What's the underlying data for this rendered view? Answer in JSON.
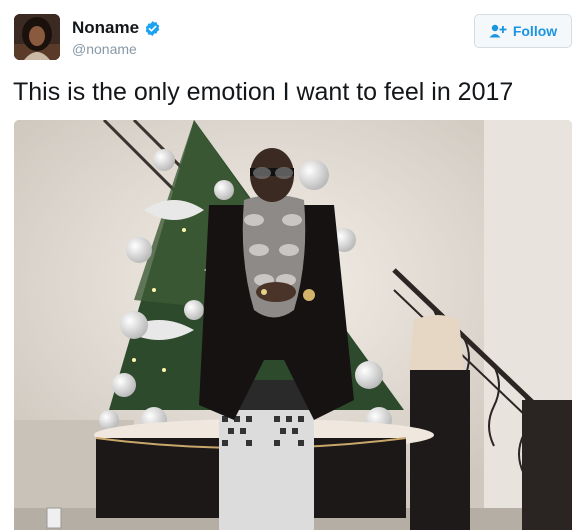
{
  "tweet": {
    "author": {
      "display_name": "Noname",
      "handle": "@noname",
      "verified": true,
      "avatar_icon": "profile-photo"
    },
    "follow_button": {
      "label": "Follow",
      "icon": "add-user-icon"
    },
    "text": "This is the only emotion I want to feel in 2017",
    "media": {
      "type": "photo",
      "icon": "photo-christmas-tree"
    }
  },
  "colors": {
    "accent": "#1b95e0",
    "verified": "#1da1f2",
    "handle": "#8899a6",
    "text": "#14171a"
  }
}
